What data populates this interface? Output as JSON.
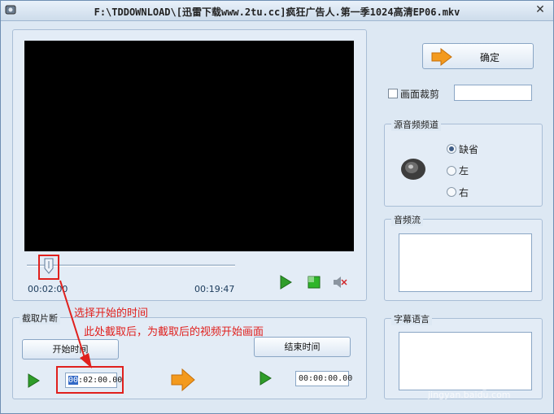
{
  "window": {
    "title": "F:\\TDDOWNLOAD\\[迅雷下载www.2tu.cc]疯狂广告人.第一季1024高清EP06.mkv"
  },
  "confirm_button": "确定",
  "crop": {
    "label": "画面裁剪",
    "value": ""
  },
  "source_channel": {
    "title": "源音频频道",
    "options": [
      "缺省",
      "左",
      "右"
    ],
    "selected": "缺省"
  },
  "audio_stream": {
    "title": "音频流"
  },
  "subtitle_language": {
    "title": "字幕语言"
  },
  "player": {
    "current_time": "00:02:00",
    "total_time": "00:19:47",
    "slider_fraction": 0.1
  },
  "clip": {
    "title": "截取片断",
    "start_button": "开始时间",
    "end_button": "结束时间",
    "start_time_selected": "00",
    "start_time_rest": ":02:00.00",
    "end_time": "00:00:00.00"
  },
  "annotation": {
    "line1": "选择开始的时间",
    "line2": "此处截取后，为截取后的视频开始画面"
  },
  "watermark": {
    "brand": "Bai经验",
    "url": "jingyan.baidu.com"
  },
  "colors": {
    "annotation": "#e0201d",
    "selection": "#3168c6"
  }
}
